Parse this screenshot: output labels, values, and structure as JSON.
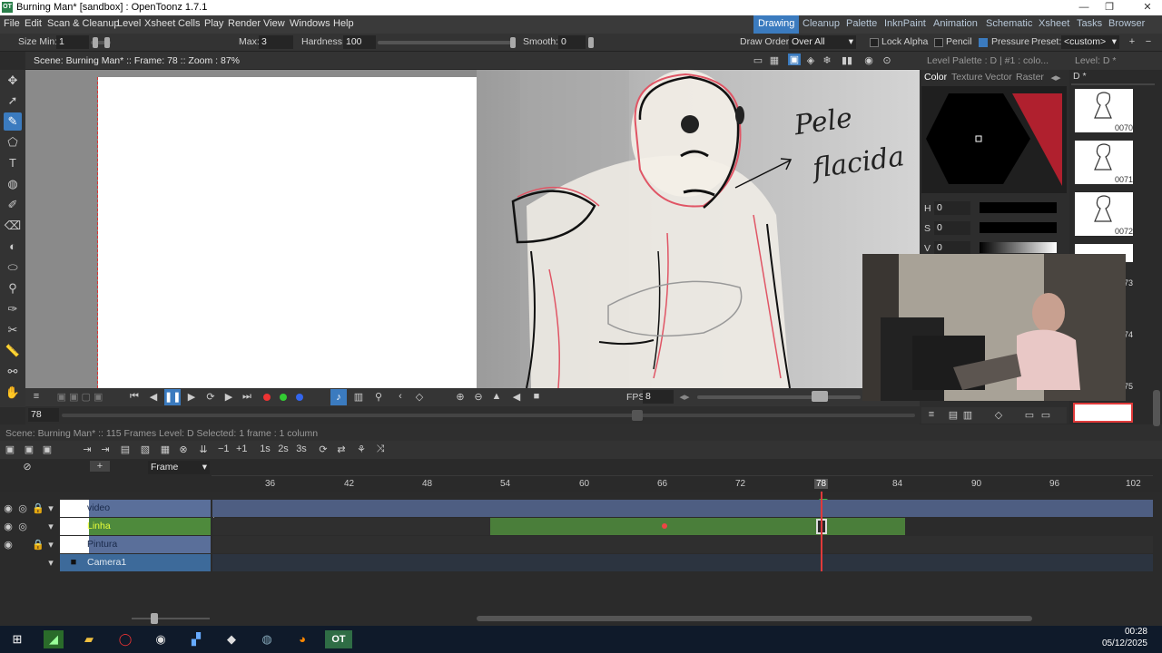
{
  "window": {
    "title": "Burning Man* [sandbox] : OpenToonz 1.7.1",
    "logo": "OT"
  },
  "menu": [
    "File",
    "Edit",
    "Scan & Cleanup",
    "Level",
    "Xsheet",
    "Cells",
    "Play",
    "Render",
    "View",
    "Windows",
    "Help"
  ],
  "rooms": [
    "Drawing",
    "Cleanup",
    "Palette",
    "InknPaint",
    "Animation",
    "Schematic",
    "Xsheet",
    "Tasks",
    "Browser"
  ],
  "active_room": "Drawing",
  "tool_options": {
    "size_min_label": "Size Min:",
    "size_min": "1",
    "max_label": "Max:",
    "max": "3",
    "hardness_label": "Hardness:",
    "hardness": "100",
    "smooth_label": "Smooth:",
    "smooth": "0",
    "draw_order_label": "Draw Order:",
    "draw_order": "Over All",
    "lock_alpha": "Lock Alpha",
    "pencil": "Pencil",
    "pressure": "Pressure",
    "preset_label": "Preset:",
    "preset": "<custom>"
  },
  "viewer": {
    "info": "Scene: Burning Man*  ::  Frame: 78  ::  Zoom : 87%",
    "frame_field": "78",
    "fps_label": "FPS",
    "fps": "8"
  },
  "drawing_text": {
    "line1": "Pele",
    "line2": "flacida"
  },
  "palette": {
    "header": "Level Palette : D | #1 : colo...",
    "tabs": [
      "Color",
      "Texture",
      "Vector",
      "Raster"
    ],
    "h_label": "H",
    "h": "0",
    "s_label": "S",
    "s": "0",
    "v_label": "V",
    "v": "0"
  },
  "level_strip": {
    "header": "Level: D *",
    "level": "D *",
    "frames": [
      "0070",
      "0071",
      "0072",
      "0073",
      "0074",
      "0075"
    ]
  },
  "xsheet": {
    "status": "Scene: Burning Man*  ::  115 Frames  Level: D  Selected: 1 frame : 1 column",
    "frame_mode": "Frame",
    "ticks": [
      "36",
      "42",
      "48",
      "54",
      "60",
      "66",
      "72",
      "78",
      "84",
      "90",
      "96",
      "102"
    ],
    "current_frame": "78",
    "columns": [
      {
        "name": "video",
        "color": "#5a6f9a"
      },
      {
        "name": "Linha",
        "color": "#4e8a3c"
      },
      {
        "name": "Pintura",
        "color": "#5a6f9a"
      },
      {
        "name": "Camera1",
        "color": "#3d6a9a"
      }
    ]
  },
  "taskbar": {
    "time": "00:28",
    "date": "05/12/2025"
  }
}
